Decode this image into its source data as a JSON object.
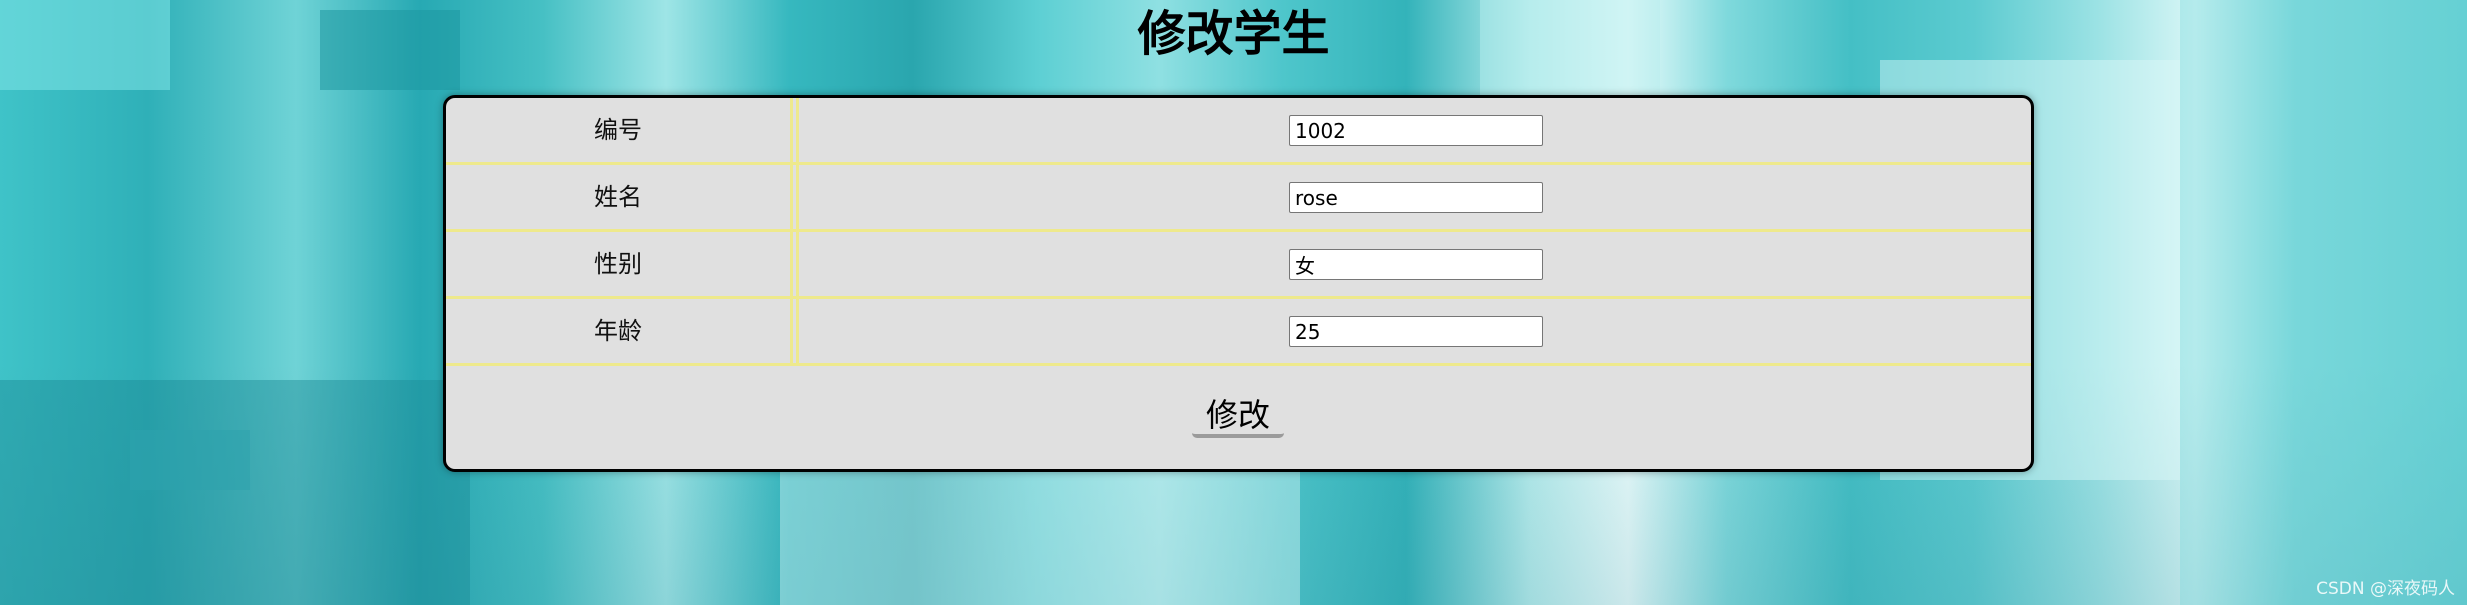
{
  "page": {
    "title": "修改学生"
  },
  "form": {
    "fields": [
      {
        "label": "编号",
        "value": "1002"
      },
      {
        "label": "姓名",
        "value": "rose"
      },
      {
        "label": "性别",
        "value": "女"
      },
      {
        "label": "年龄",
        "value": "25"
      }
    ],
    "submit_label": "修改"
  },
  "watermark": "CSDN @深夜码人"
}
